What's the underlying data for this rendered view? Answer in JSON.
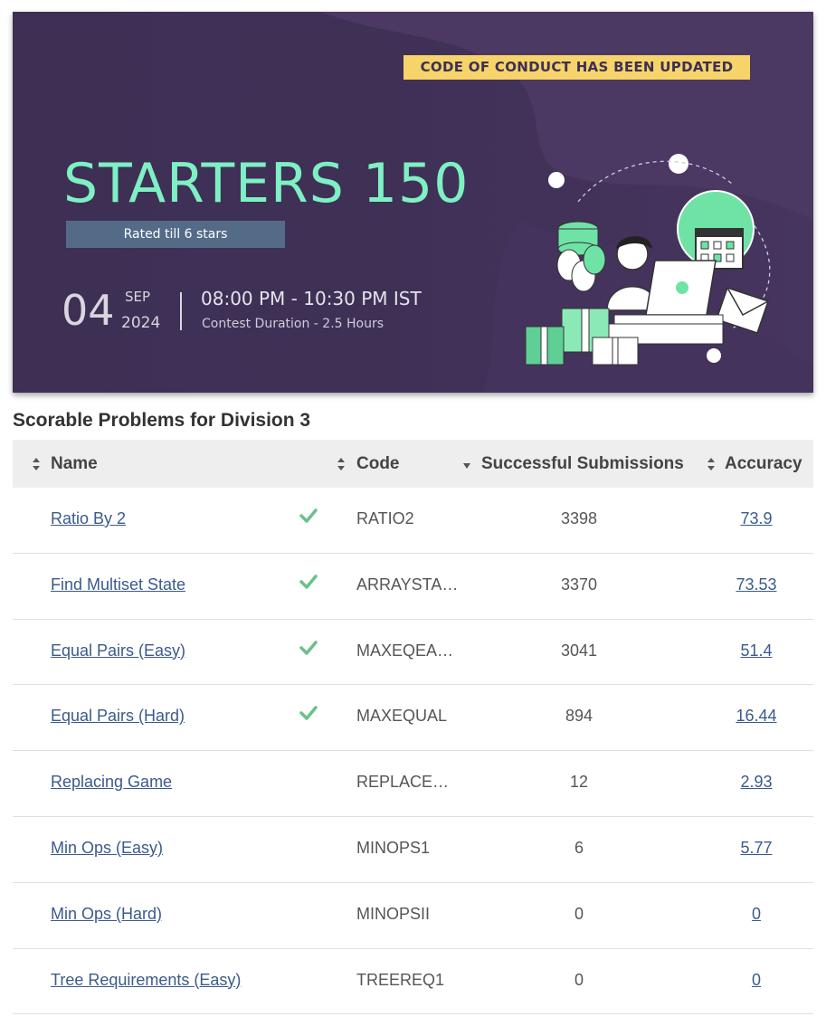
{
  "banner": {
    "notice": "CODE OF CONDUCT HAS BEEN UPDATED",
    "title": "STARTERS 150",
    "rated": "Rated till 6 stars",
    "day": "04",
    "month": "SEP",
    "year": "2024",
    "time": "08:00 PM - 10:30 PM IST",
    "duration": "Contest Duration - 2.5  Hours"
  },
  "section_title": "Scorable Problems for Division 3",
  "table": {
    "headers": {
      "name": "Name",
      "code": "Code",
      "submissions": "Successful Submissions",
      "accuracy": "Accuracy"
    },
    "rows": [
      {
        "name": "Ratio By 2",
        "solved": true,
        "code": "RATIO2",
        "submissions": "3398",
        "accuracy": "73.9"
      },
      {
        "name": "Find Multiset State",
        "solved": true,
        "code": "ARRAYSTA…",
        "submissions": "3370",
        "accuracy": "73.53"
      },
      {
        "name": "Equal Pairs (Easy)",
        "solved": true,
        "code": "MAXEQEA…",
        "submissions": "3041",
        "accuracy": "51.4"
      },
      {
        "name": "Equal Pairs (Hard)",
        "solved": true,
        "code": "MAXEQUAL",
        "submissions": "894",
        "accuracy": "16.44"
      },
      {
        "name": "Replacing Game",
        "solved": false,
        "code": "REPLACE…",
        "submissions": "12",
        "accuracy": "2.93"
      },
      {
        "name": "Min Ops (Easy)",
        "solved": false,
        "code": "MINOPS1",
        "submissions": "6",
        "accuracy": "5.77"
      },
      {
        "name": "Min Ops (Hard)",
        "solved": false,
        "code": "MINOPSII",
        "submissions": "0",
        "accuracy": "0"
      },
      {
        "name": "Tree Requirements (Easy)",
        "solved": false,
        "code": "TREEREQ1",
        "submissions": "0",
        "accuracy": "0"
      }
    ]
  },
  "colors": {
    "banner_bg": "#3e2f55",
    "title": "#7ef0c4",
    "notice_bg": "#f6d469",
    "link": "#3b5a8c",
    "check": "#6cc08b"
  }
}
